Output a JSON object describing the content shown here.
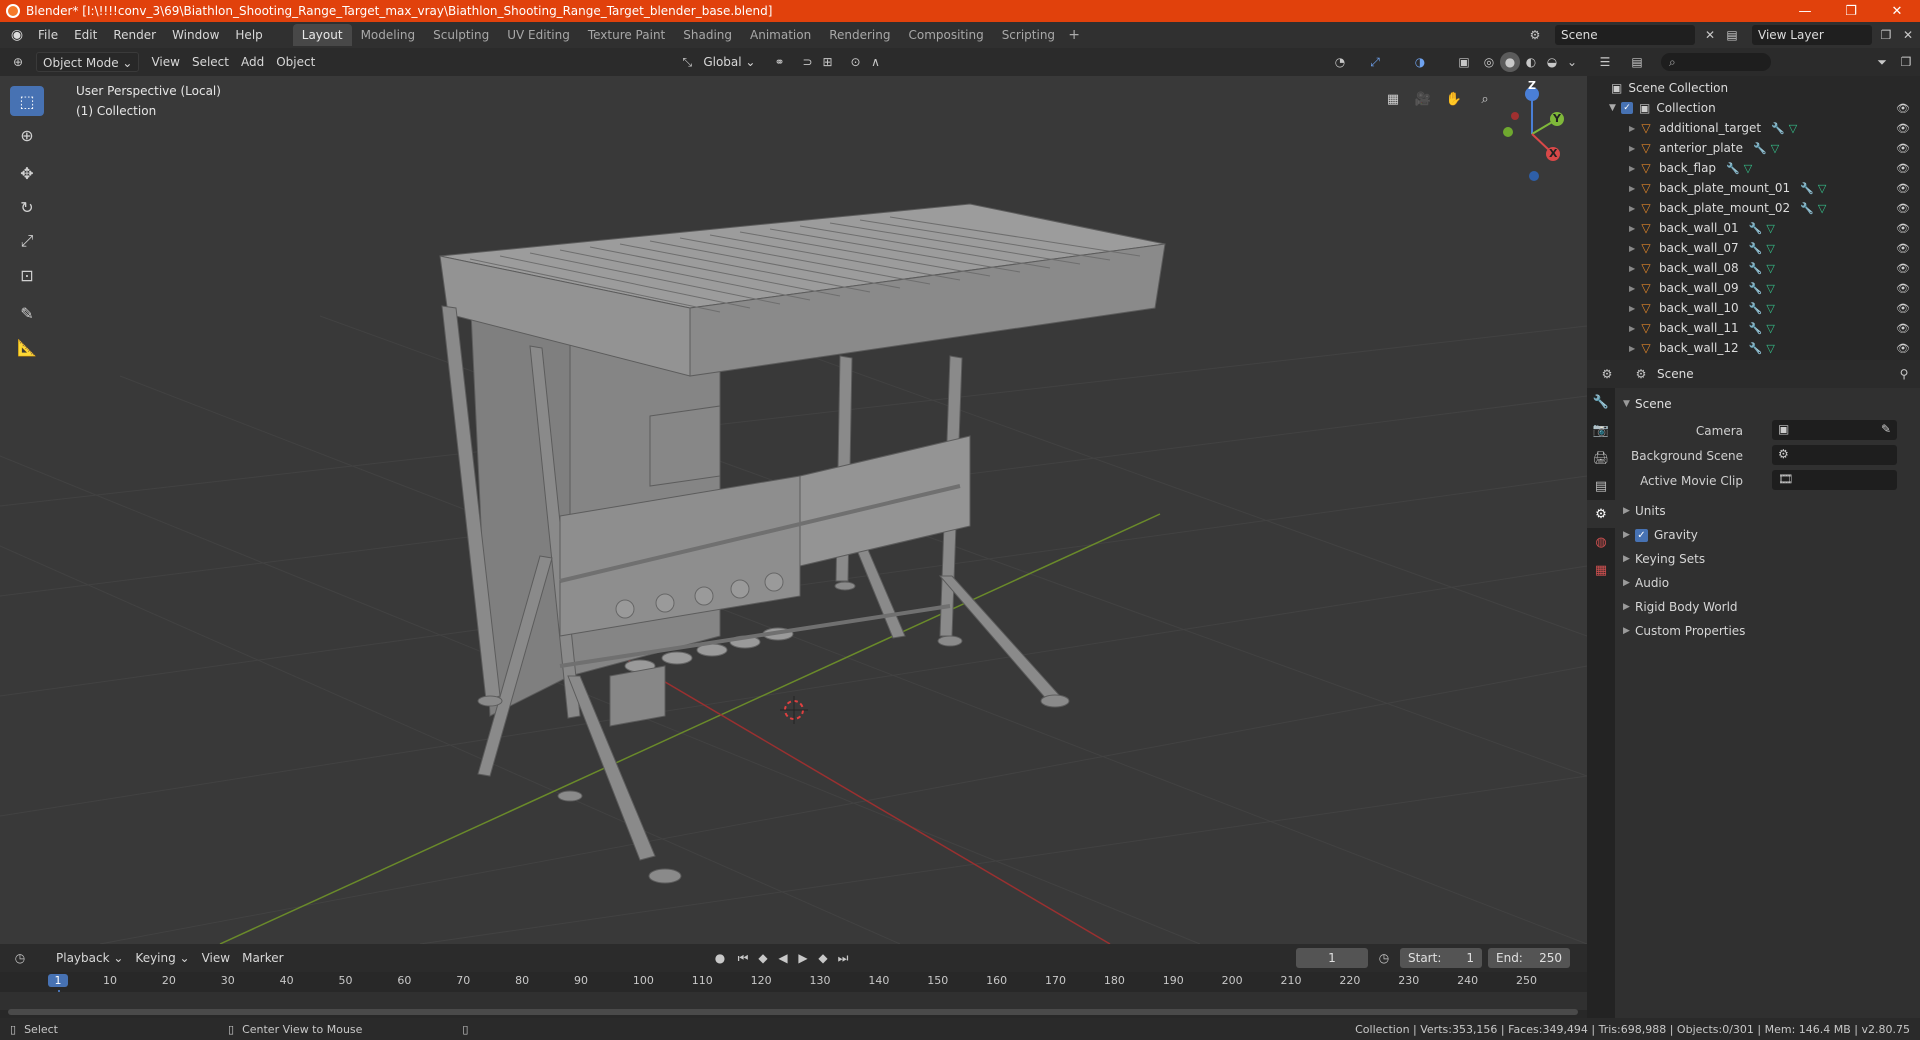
{
  "window": {
    "title": "Blender* [I:\\!!!!conv_3\\69\\Biathlon_Shooting_Range_Target_max_vray\\Biathlon_Shooting_Range_Target_blender_base.blend]",
    "minimize": "—",
    "maximize": "❐",
    "close": "✕"
  },
  "menu": {
    "file": "File",
    "edit": "Edit",
    "render": "Render",
    "window": "Window",
    "help": "Help"
  },
  "workspaces": [
    "Layout",
    "Modeling",
    "Sculpting",
    "UV Editing",
    "Texture Paint",
    "Shading",
    "Animation",
    "Rendering",
    "Compositing",
    "Scripting"
  ],
  "active_workspace": "Layout",
  "scene_selector": {
    "value": "Scene"
  },
  "view_layer_selector": {
    "value": "View Layer"
  },
  "viewport_header": {
    "mode": "Object Mode",
    "view": "View",
    "select": "Select",
    "add": "Add",
    "object": "Object",
    "transform_orientation": "Global"
  },
  "viewport": {
    "perspective_label": "User Perspective (Local)",
    "collection_label": "(1) Collection",
    "gizmo": {
      "z": "Z",
      "y": "Y",
      "x": "X"
    }
  },
  "toolbar_tools": [
    "select-box-tool",
    "cursor-tool",
    "move-tool",
    "rotate-tool",
    "scale-tool",
    "transform-tool",
    "annotate-tool",
    "measure-tool"
  ],
  "outliner": {
    "root": "Scene Collection",
    "collection": "Collection",
    "objects": [
      "additional_target",
      "anterior_plate",
      "back_flap",
      "back_plate_mount_01",
      "back_plate_mount_02",
      "back_wall_01",
      "back_wall_07",
      "back_wall_08",
      "back_wall_09",
      "back_wall_10",
      "back_wall_11",
      "back_wall_12"
    ]
  },
  "properties": {
    "header": "Scene",
    "panel": "Scene",
    "camera_label": "Camera",
    "background_scene_label": "Background Scene",
    "active_movie_clip_label": "Active Movie Clip",
    "subpanels": [
      "Units",
      "Gravity",
      "Keying Sets",
      "Audio",
      "Rigid Body World",
      "Custom Properties"
    ],
    "gravity_checked": true
  },
  "timeline": {
    "playback": "Playback",
    "keying": "Keying",
    "view": "View",
    "marker": "Marker",
    "current_frame": "1",
    "start_label": "Start:",
    "start": "1",
    "end_label": "End:",
    "end": "250",
    "ticks": [
      "1",
      "10",
      "20",
      "30",
      "40",
      "50",
      "60",
      "70",
      "80",
      "90",
      "100",
      "110",
      "120",
      "130",
      "140",
      "150",
      "160",
      "170",
      "180",
      "190",
      "200",
      "210",
      "220",
      "230",
      "240",
      "250"
    ]
  },
  "statusbar": {
    "select": "Select",
    "center_view": "Center View to Mouse",
    "stats": "Collection | Verts:353,156 | Faces:349,494 | Tris:698,988 | Objects:0/301 | Mem: 146.4 MB | v2.80.75"
  },
  "colors": {
    "titlebar": "#e1410c",
    "accent": "#4772b3",
    "object_icon": "#e0852a",
    "mesh_icon": "#35c08a",
    "modifier_icon": "#6b9ee6"
  }
}
